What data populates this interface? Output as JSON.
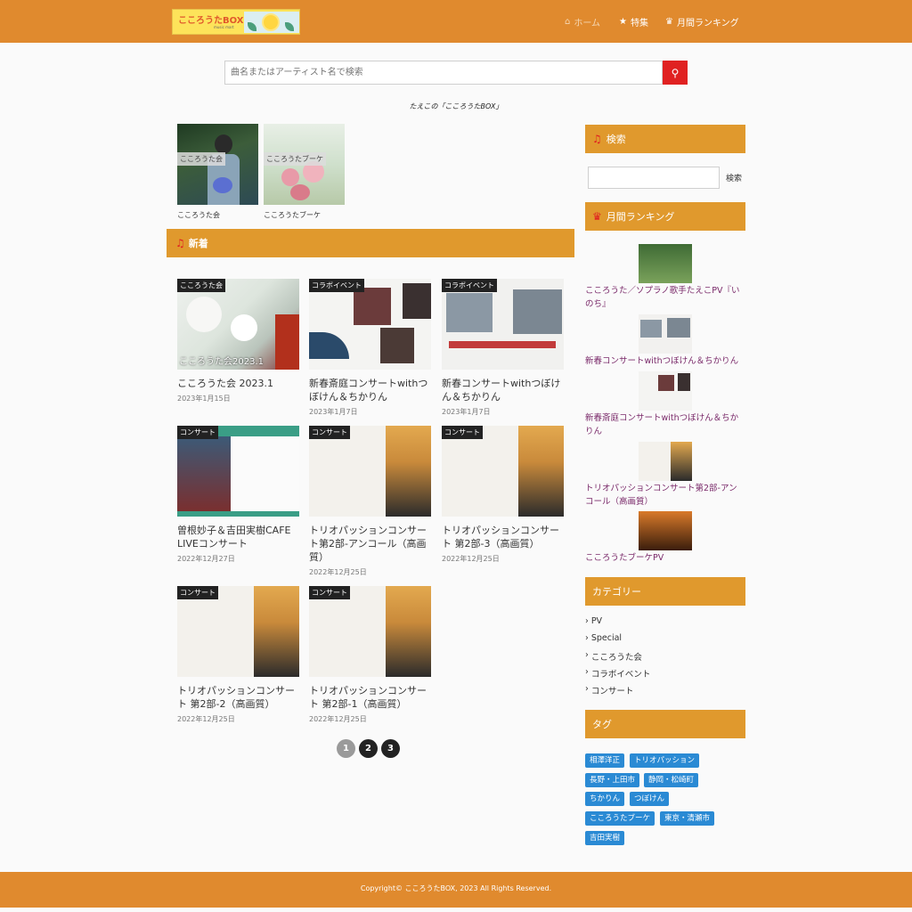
{
  "header": {
    "logo_text": "こころうたBOX",
    "logo_sub": "music mart",
    "nav": [
      {
        "label": "ホーム",
        "icon": "home-icon"
      },
      {
        "label": "特集",
        "icon": "star-icon"
      },
      {
        "label": "月間ランキング",
        "icon": "crown-icon"
      }
    ]
  },
  "search": {
    "placeholder": "曲名またはアーティスト名で検索"
  },
  "tagline": "たえこの「こころうたBOX」",
  "featured": [
    {
      "label": "こころうた会",
      "caption": "こころうた会"
    },
    {
      "label": "こころうたブーケ",
      "caption": "こころうたブーケ"
    }
  ],
  "section": {
    "title": "新着"
  },
  "cards": [
    {
      "cat": "こころうた会",
      "title": "こころうた会 2023.1",
      "date": "2023年1月15日"
    },
    {
      "cat": "コラボイベント",
      "title": "新春斎庭コンサートwithつぼけん＆ちかりん",
      "date": "2023年1月7日"
    },
    {
      "cat": "コラボイベント",
      "title": "新春コンサートwithつぼけん＆ちかりん",
      "date": "2023年1月7日"
    },
    {
      "cat": "コンサート",
      "title": "曽根妙子＆吉田実樹CAFE LIVEコンサート",
      "date": "2022年12月27日"
    },
    {
      "cat": "コンサート",
      "title": "トリオパッションコンサート第2部-アンコール（高画質）",
      "date": "2022年12月25日"
    },
    {
      "cat": "コンサート",
      "title": "トリオパッションコンサート 第2部-3（高画質）",
      "date": "2022年12月25日"
    },
    {
      "cat": "コンサート",
      "title": "トリオパッションコンサート 第2部-2（高画質）",
      "date": "2022年12月25日"
    },
    {
      "cat": "コンサート",
      "title": "トリオパッションコンサート 第2部-1（高画質）",
      "date": "2022年12月25日"
    }
  ],
  "card_overlay_text": "こころうた会2023.1",
  "pagination": [
    "1",
    "2",
    "3"
  ],
  "sidebar": {
    "search_title": "検索",
    "search_btn": "検索",
    "ranking_title": "月間ランキング",
    "ranking": [
      "こころうた／ソプラノ歌手たえこPV『いのち』",
      "新春コンサートwithつぼけん＆ちかりん",
      "新春斎庭コンサートwithつぼけん＆ちかりん",
      "トリオパッションコンサート第2部-アンコール（高画質）",
      "こころうたブーケPV"
    ],
    "category_title": "カテゴリー",
    "categories": [
      "PV",
      "Special",
      "こころうた会",
      "コラボイベント",
      "コンサート"
    ],
    "tag_title": "タグ",
    "tags": [
      "相澤洋正",
      "トリオパッション",
      "長野・上田市",
      "静岡・松崎町",
      "ちかりん",
      "つぼけん",
      "こころうたブーケ",
      "東京・清瀬市",
      "吉田実樹"
    ]
  },
  "footer": {
    "copyright": "Copyright© こころうたBOX, 2023 All Rights Reserved."
  },
  "colors": {
    "header": "#e08a2e",
    "section": "#e0992d",
    "accent_red": "#e02121",
    "tag": "#2a8ad4",
    "rank_link": "#7a2a6a"
  }
}
